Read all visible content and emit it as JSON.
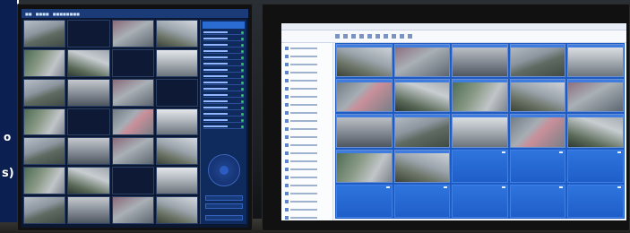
{
  "caption": {
    "line1": "o",
    "line2": "s)"
  },
  "left_screen": {
    "title": "",
    "tab_labels": [
      "",
      "",
      ""
    ],
    "camera_count": 28,
    "panel_rows": 16
  },
  "right_screen": {
    "grid_rows": 5,
    "grid_cols": 5,
    "live_cameras": 17,
    "empty_tiles": 8
  },
  "colors": {
    "screen_blue": "#1f5ec8",
    "panel_navy": "#0f2a5c",
    "caption_bg": "#0b2050"
  }
}
